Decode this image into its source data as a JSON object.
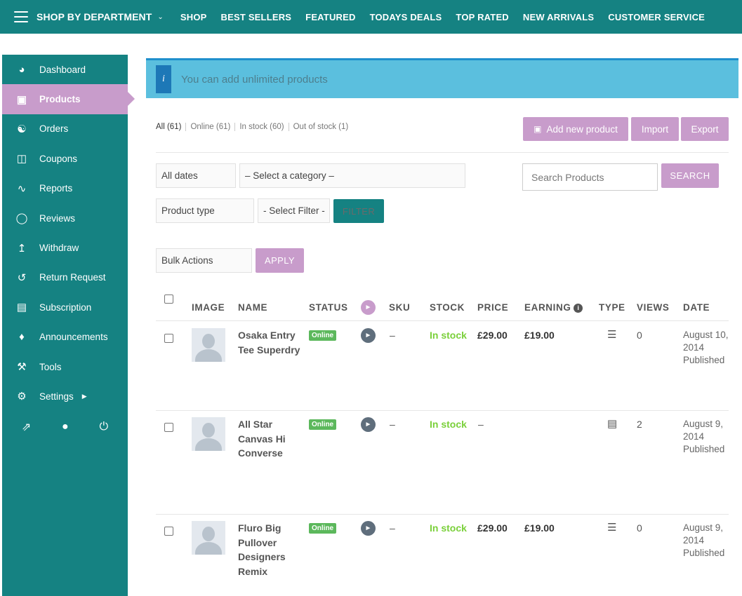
{
  "topbar": {
    "department_label": "SHOP BY DEPARTMENT",
    "nav": [
      "SHOP",
      "BEST SELLERS",
      "FEATURED",
      "TODAYS DEALS",
      "TOP RATED",
      "NEW ARRIVALS",
      "CUSTOMER SERVICE"
    ]
  },
  "sidebar": {
    "items": [
      {
        "label": "Dashboard",
        "icon": "dashboard-icon"
      },
      {
        "label": "Products",
        "icon": "briefcase-icon"
      },
      {
        "label": "Orders",
        "icon": "cart-icon"
      },
      {
        "label": "Coupons",
        "icon": "gift-icon"
      },
      {
        "label": "Reports",
        "icon": "chart-icon"
      },
      {
        "label": "Reviews",
        "icon": "comments-icon"
      },
      {
        "label": "Withdraw",
        "icon": "upload-icon"
      },
      {
        "label": "Return Request",
        "icon": "undo-icon"
      },
      {
        "label": "Subscription",
        "icon": "book-icon"
      },
      {
        "label": "Announcements",
        "icon": "bell-icon"
      },
      {
        "label": "Tools",
        "icon": "wrench-icon"
      },
      {
        "label": "Settings",
        "icon": "gear-icon"
      }
    ],
    "active_index": 1
  },
  "alert": {
    "text": "You can add unlimited products",
    "icon": "i"
  },
  "status_filters": [
    "All (61)",
    "Online (61)",
    "In stock (60)",
    "Out of stock (1)"
  ],
  "buttons": {
    "add_new": "Add new product",
    "import": "Import",
    "export": "Export",
    "search": "SEARCH",
    "filter": "FILTER",
    "apply": "APPLY"
  },
  "filters": {
    "dates": "All dates",
    "category": "– Select a category –",
    "product_type": "Product type",
    "select_filter": "- Select Filter -",
    "bulk_actions": "Bulk Actions",
    "search_placeholder": "Search Products"
  },
  "table": {
    "headers": {
      "image": "IMAGE",
      "name": "NAME",
      "status": "STATUS",
      "sku": "SKU",
      "stock": "STOCK",
      "price": "PRICE",
      "earning": "EARNING",
      "type": "TYPE",
      "views": "VIEWS",
      "date": "DATE"
    },
    "rows": [
      {
        "name": "Osaka Entry Tee Superdry",
        "status": "Online",
        "sku": "–",
        "stock": "In stock",
        "price": "£29.00",
        "earning": "£19.00",
        "type": "variable-icon",
        "views": "0",
        "date": "August 10, 2014",
        "date_status": "Published"
      },
      {
        "name": "All Star Canvas Hi Converse",
        "status": "Online",
        "sku": "–",
        "stock": "In stock",
        "price": "–",
        "earning": "",
        "type": "book-icon",
        "views": "2",
        "date": "August 9, 2014",
        "date_status": "Published"
      },
      {
        "name": "Fluro Big Pullover Designers Remix",
        "status": "Online",
        "sku": "–",
        "stock": "In stock",
        "price": "£29.00",
        "earning": "£19.00",
        "type": "variable-icon",
        "views": "0",
        "date": "August 9, 2014",
        "date_status": "Published"
      }
    ]
  },
  "colors": {
    "primary_teal": "#158282",
    "accent_purple": "#c89ccb",
    "alert_blue": "#5bbfde",
    "in_stock_green": "#7ad03a",
    "online_badge": "#5cb85c"
  }
}
